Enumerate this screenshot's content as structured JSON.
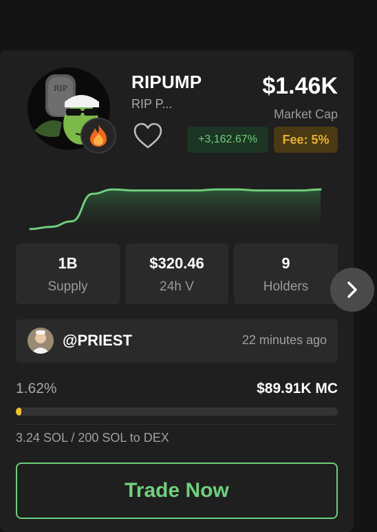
{
  "token": {
    "name": "RIPUMP",
    "short_desc": "RIP P...",
    "market_cap": "$1.46K",
    "market_cap_label": "Market Cap",
    "change_pct": "+3,162.67%",
    "fee": "Fee: 5%",
    "avatar_text": "RIP",
    "accent_color": "#6fcf7d",
    "fee_color": "#e6b030",
    "icons": [
      "fire-icon",
      "heart-icon",
      "chevron-right-icon"
    ]
  },
  "chart_data": {
    "type": "area",
    "x": [
      0,
      1,
      2,
      3,
      4,
      5,
      6,
      7,
      8,
      9,
      10,
      11,
      12,
      13,
      14
    ],
    "values": [
      2,
      4,
      9,
      34,
      38,
      37,
      37,
      37,
      37,
      38,
      38,
      37,
      37,
      37,
      38
    ],
    "ylim": [
      0,
      45
    ],
    "grid": false,
    "line_color": "#6fcf7d"
  },
  "stats": [
    {
      "value": "1B",
      "label": "Supply"
    },
    {
      "value": "$320.46",
      "label": "24h V"
    },
    {
      "value": "9",
      "label": "Holders"
    }
  ],
  "creator": {
    "handle": "@PRIEST",
    "time": "22 minutes ago"
  },
  "progress": {
    "percent_text": "1.62%",
    "fraction": 0.0162,
    "target": "$89.91K MC",
    "sol_text": "3.24 SOL / 200 SOL to DEX"
  },
  "actions": {
    "trade_label": "Trade Now"
  }
}
